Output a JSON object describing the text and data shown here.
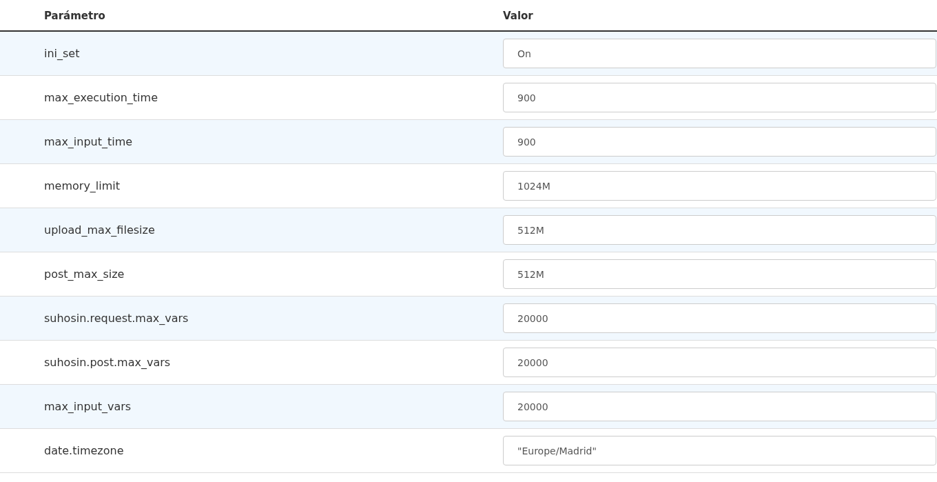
{
  "table": {
    "columns": [
      "Parámetro",
      "Valor"
    ],
    "rows": [
      {
        "parameter": "ini_set",
        "value": "On"
      },
      {
        "parameter": "max_execution_time",
        "value": "900"
      },
      {
        "parameter": "max_input_time",
        "value": "900"
      },
      {
        "parameter": "memory_limit",
        "value": "1024M"
      },
      {
        "parameter": "upload_max_filesize",
        "value": "512M"
      },
      {
        "parameter": "post_max_size",
        "value": "512M"
      },
      {
        "parameter": "suhosin.request.max_vars",
        "value": "20000"
      },
      {
        "parameter": "suhosin.post.max_vars",
        "value": "20000"
      },
      {
        "parameter": "max_input_vars",
        "value": "20000"
      },
      {
        "parameter": "date.timezone",
        "value": "\"Europe/Madrid\""
      }
    ]
  }
}
